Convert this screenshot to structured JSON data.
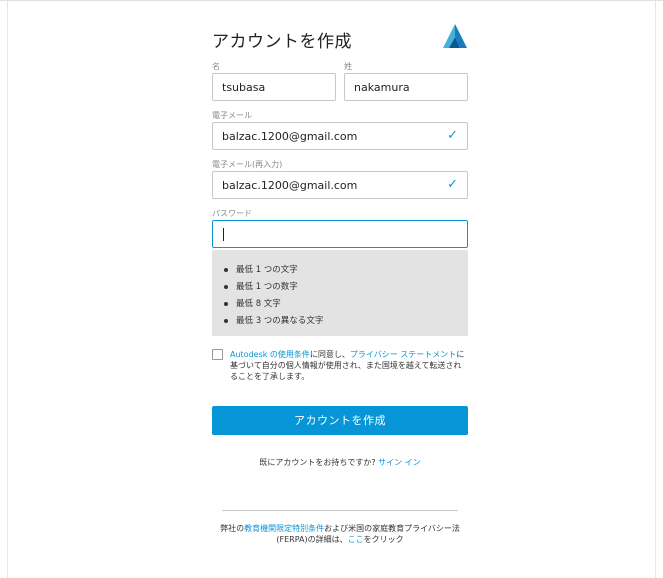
{
  "header": {
    "title": "アカウントを作成",
    "logo": "autodesk-logo-icon"
  },
  "form": {
    "first_name": {
      "label": "名",
      "value": "tsubasa"
    },
    "last_name": {
      "label": "姓",
      "value": "nakamura"
    },
    "email": {
      "label": "電子メール",
      "value": "balzac.1200@gmail.com",
      "valid_icon": "✓"
    },
    "email_confirm": {
      "label": "電子メール(再入力)",
      "value": "balzac.1200@gmail.com",
      "valid_icon": "✓"
    },
    "password": {
      "label": "パスワード",
      "value": ""
    },
    "password_requirements": [
      "最低 1 つの文字",
      "最低 1 つの数字",
      "最低 8 文字",
      "最低 3 つの異なる文字"
    ]
  },
  "terms": {
    "checked": false,
    "part1": "Autodesk の使用条件",
    "part2": "に同意し、",
    "part3": "プライバシー ステートメント",
    "part4": "に基づいて自分の個人情報が使用され、また国境を越えて転送されることを了承します。"
  },
  "submit_label": "アカウントを作成",
  "signin": {
    "prompt": "既にアカウントをお持ちですか?",
    "link": "サイン イン"
  },
  "footer": {
    "part1": "弊社の",
    "link1": "教育機関限定特別条件",
    "part2": "および米国の家庭教育プライバシー法(FERPA)の詳細は、",
    "link2": "ここ",
    "part3": "をクリック"
  },
  "colors": {
    "accent": "#0696d7",
    "requirements_bg": "#e3e3e3"
  }
}
